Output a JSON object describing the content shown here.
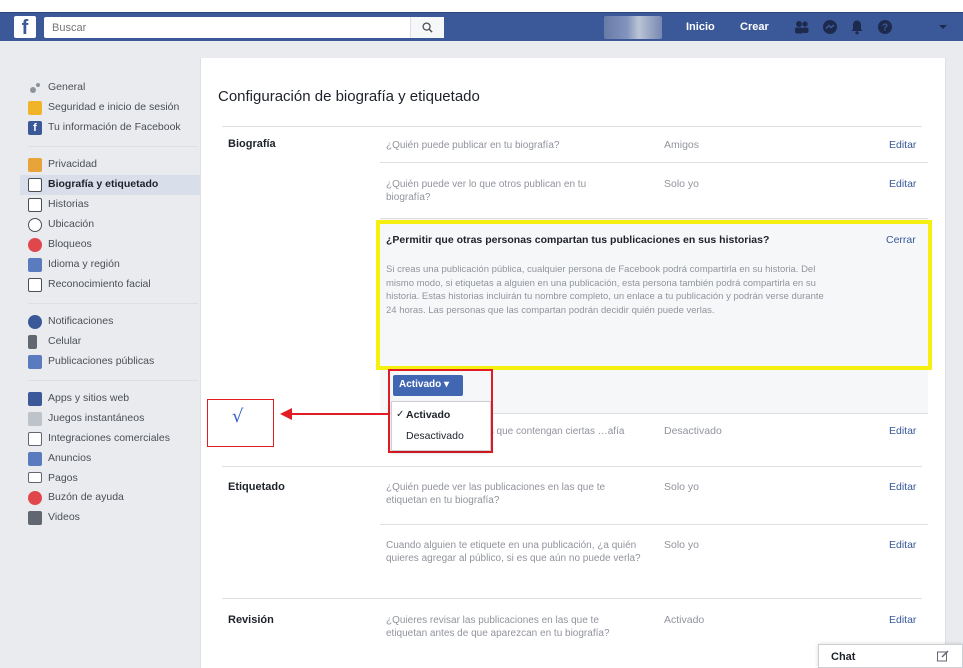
{
  "topbar": {
    "logo": "f",
    "search_placeholder": "Buscar",
    "nav_home": "Inicio",
    "nav_create": "Crear",
    "icons": [
      "friends-icon",
      "messenger-icon",
      "notifications-icon",
      "help-icon",
      "caret-down-icon"
    ]
  },
  "sidebar": {
    "groups": [
      [
        {
          "label": "General",
          "icon": "gear-icon"
        },
        {
          "label": "Seguridad e inicio de sesión",
          "icon": "shield-icon"
        },
        {
          "label": "Tu información de Facebook",
          "icon": "facebook-icon"
        }
      ],
      [
        {
          "label": "Privacidad",
          "icon": "lock-icon"
        },
        {
          "label": "Biografía y etiquetado",
          "icon": "timeline-icon",
          "selected": true
        },
        {
          "label": "Historias",
          "icon": "book-icon"
        },
        {
          "label": "Ubicación",
          "icon": "location-icon"
        },
        {
          "label": "Bloqueos",
          "icon": "block-icon"
        },
        {
          "label": "Idioma y región",
          "icon": "language-icon"
        },
        {
          "label": "Reconocimiento facial",
          "icon": "face-icon"
        }
      ],
      [
        {
          "label": "Notificaciones",
          "icon": "globe-icon"
        },
        {
          "label": "Celular",
          "icon": "phone-icon"
        },
        {
          "label": "Publicaciones públicas",
          "icon": "rss-icon"
        }
      ],
      [
        {
          "label": "Apps y sitios web",
          "icon": "apps-icon"
        },
        {
          "label": "Juegos instantáneos",
          "icon": "games-icon"
        },
        {
          "label": "Integraciones comerciales",
          "icon": "integrations-icon"
        },
        {
          "label": "Anuncios",
          "icon": "ads-icon"
        },
        {
          "label": "Pagos",
          "icon": "card-icon"
        },
        {
          "label": "Buzón de ayuda",
          "icon": "lifebuoy-icon"
        },
        {
          "label": "Videos",
          "icon": "video-icon"
        }
      ]
    ]
  },
  "main": {
    "title": "Configuración de biografía y etiquetado",
    "sections": {
      "biografia": "Biografía",
      "etiquetado": "Etiquetado",
      "revision": "Revisión"
    },
    "rows": [
      {
        "question": "¿Quién puede publicar en tu biografía?",
        "value": "Amigos",
        "action": "Editar"
      },
      {
        "question": "¿Quién puede ver lo que otros publican en tu biografía?",
        "value": "Solo yo",
        "action": "Editar"
      },
      {
        "question": "…las que contengan ciertas …afía",
        "value": "Desactivado",
        "action": "Editar"
      },
      {
        "question": "¿Quién puede ver las publicaciones en las que te etiquetan en tu biografía?",
        "value": "Solo yo",
        "action": "Editar"
      },
      {
        "question": "Cuando alguien te etiquete en una publicación, ¿a quién quieres agregar al público, si es que aún no puede verla?",
        "value": "Solo yo",
        "action": "Editar"
      },
      {
        "question": "¿Quieres revisar las publicaciones en las que te etiquetan antes de que aparezcan en tu biografía?",
        "value": "Activado",
        "action": "Editar"
      }
    ],
    "expanded": {
      "question": "¿Permitir que otras personas compartan tus publicaciones en sus historias?",
      "close": "Cerrar",
      "description": "Si creas una publicación pública, cualquier persona de Facebook podrá compartirla en su historia. Del mismo modo, si etiquetas a alguien en una publicación, esta persona también podrá compartirla en su historia. Estas historias incluirán tu nombre completo, un enlace a tu publicación y podrán verse durante 24 horas. Las personas que las compartan podrán decidir quién puede verlas.",
      "dropdown_value": "Activado",
      "options": [
        "Activado",
        "Desactivado"
      ],
      "selected_option": "Activado"
    }
  },
  "annotation": {
    "check": "√"
  },
  "chat": {
    "label": "Chat"
  },
  "colors": {
    "fb_blue": "#3b5998",
    "highlight_yellow": "#f5f010",
    "annotation_red": "#e31b23"
  }
}
